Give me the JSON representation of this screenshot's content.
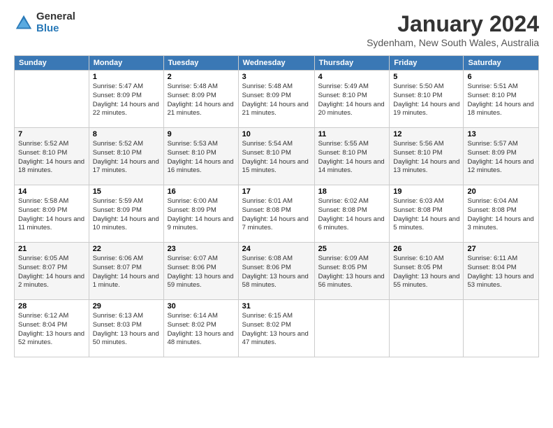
{
  "logo": {
    "general": "General",
    "blue": "Blue"
  },
  "title": "January 2024",
  "location": "Sydenham, New South Wales, Australia",
  "days_header": [
    "Sunday",
    "Monday",
    "Tuesday",
    "Wednesday",
    "Thursday",
    "Friday",
    "Saturday"
  ],
  "weeks": [
    [
      {
        "num": "",
        "sunrise": "",
        "sunset": "",
        "daylight": ""
      },
      {
        "num": "1",
        "sunrise": "Sunrise: 5:47 AM",
        "sunset": "Sunset: 8:09 PM",
        "daylight": "Daylight: 14 hours and 22 minutes."
      },
      {
        "num": "2",
        "sunrise": "Sunrise: 5:48 AM",
        "sunset": "Sunset: 8:09 PM",
        "daylight": "Daylight: 14 hours and 21 minutes."
      },
      {
        "num": "3",
        "sunrise": "Sunrise: 5:48 AM",
        "sunset": "Sunset: 8:09 PM",
        "daylight": "Daylight: 14 hours and 21 minutes."
      },
      {
        "num": "4",
        "sunrise": "Sunrise: 5:49 AM",
        "sunset": "Sunset: 8:10 PM",
        "daylight": "Daylight: 14 hours and 20 minutes."
      },
      {
        "num": "5",
        "sunrise": "Sunrise: 5:50 AM",
        "sunset": "Sunset: 8:10 PM",
        "daylight": "Daylight: 14 hours and 19 minutes."
      },
      {
        "num": "6",
        "sunrise": "Sunrise: 5:51 AM",
        "sunset": "Sunset: 8:10 PM",
        "daylight": "Daylight: 14 hours and 18 minutes."
      }
    ],
    [
      {
        "num": "7",
        "sunrise": "Sunrise: 5:52 AM",
        "sunset": "Sunset: 8:10 PM",
        "daylight": "Daylight: 14 hours and 18 minutes."
      },
      {
        "num": "8",
        "sunrise": "Sunrise: 5:52 AM",
        "sunset": "Sunset: 8:10 PM",
        "daylight": "Daylight: 14 hours and 17 minutes."
      },
      {
        "num": "9",
        "sunrise": "Sunrise: 5:53 AM",
        "sunset": "Sunset: 8:10 PM",
        "daylight": "Daylight: 14 hours and 16 minutes."
      },
      {
        "num": "10",
        "sunrise": "Sunrise: 5:54 AM",
        "sunset": "Sunset: 8:10 PM",
        "daylight": "Daylight: 14 hours and 15 minutes."
      },
      {
        "num": "11",
        "sunrise": "Sunrise: 5:55 AM",
        "sunset": "Sunset: 8:10 PM",
        "daylight": "Daylight: 14 hours and 14 minutes."
      },
      {
        "num": "12",
        "sunrise": "Sunrise: 5:56 AM",
        "sunset": "Sunset: 8:10 PM",
        "daylight": "Daylight: 14 hours and 13 minutes."
      },
      {
        "num": "13",
        "sunrise": "Sunrise: 5:57 AM",
        "sunset": "Sunset: 8:09 PM",
        "daylight": "Daylight: 14 hours and 12 minutes."
      }
    ],
    [
      {
        "num": "14",
        "sunrise": "Sunrise: 5:58 AM",
        "sunset": "Sunset: 8:09 PM",
        "daylight": "Daylight: 14 hours and 11 minutes."
      },
      {
        "num": "15",
        "sunrise": "Sunrise: 5:59 AM",
        "sunset": "Sunset: 8:09 PM",
        "daylight": "Daylight: 14 hours and 10 minutes."
      },
      {
        "num": "16",
        "sunrise": "Sunrise: 6:00 AM",
        "sunset": "Sunset: 8:09 PM",
        "daylight": "Daylight: 14 hours and 9 minutes."
      },
      {
        "num": "17",
        "sunrise": "Sunrise: 6:01 AM",
        "sunset": "Sunset: 8:08 PM",
        "daylight": "Daylight: 14 hours and 7 minutes."
      },
      {
        "num": "18",
        "sunrise": "Sunrise: 6:02 AM",
        "sunset": "Sunset: 8:08 PM",
        "daylight": "Daylight: 14 hours and 6 minutes."
      },
      {
        "num": "19",
        "sunrise": "Sunrise: 6:03 AM",
        "sunset": "Sunset: 8:08 PM",
        "daylight": "Daylight: 14 hours and 5 minutes."
      },
      {
        "num": "20",
        "sunrise": "Sunrise: 6:04 AM",
        "sunset": "Sunset: 8:08 PM",
        "daylight": "Daylight: 14 hours and 3 minutes."
      }
    ],
    [
      {
        "num": "21",
        "sunrise": "Sunrise: 6:05 AM",
        "sunset": "Sunset: 8:07 PM",
        "daylight": "Daylight: 14 hours and 2 minutes."
      },
      {
        "num": "22",
        "sunrise": "Sunrise: 6:06 AM",
        "sunset": "Sunset: 8:07 PM",
        "daylight": "Daylight: 14 hours and 1 minute."
      },
      {
        "num": "23",
        "sunrise": "Sunrise: 6:07 AM",
        "sunset": "Sunset: 8:06 PM",
        "daylight": "Daylight: 13 hours and 59 minutes."
      },
      {
        "num": "24",
        "sunrise": "Sunrise: 6:08 AM",
        "sunset": "Sunset: 8:06 PM",
        "daylight": "Daylight: 13 hours and 58 minutes."
      },
      {
        "num": "25",
        "sunrise": "Sunrise: 6:09 AM",
        "sunset": "Sunset: 8:05 PM",
        "daylight": "Daylight: 13 hours and 56 minutes."
      },
      {
        "num": "26",
        "sunrise": "Sunrise: 6:10 AM",
        "sunset": "Sunset: 8:05 PM",
        "daylight": "Daylight: 13 hours and 55 minutes."
      },
      {
        "num": "27",
        "sunrise": "Sunrise: 6:11 AM",
        "sunset": "Sunset: 8:04 PM",
        "daylight": "Daylight: 13 hours and 53 minutes."
      }
    ],
    [
      {
        "num": "28",
        "sunrise": "Sunrise: 6:12 AM",
        "sunset": "Sunset: 8:04 PM",
        "daylight": "Daylight: 13 hours and 52 minutes."
      },
      {
        "num": "29",
        "sunrise": "Sunrise: 6:13 AM",
        "sunset": "Sunset: 8:03 PM",
        "daylight": "Daylight: 13 hours and 50 minutes."
      },
      {
        "num": "30",
        "sunrise": "Sunrise: 6:14 AM",
        "sunset": "Sunset: 8:02 PM",
        "daylight": "Daylight: 13 hours and 48 minutes."
      },
      {
        "num": "31",
        "sunrise": "Sunrise: 6:15 AM",
        "sunset": "Sunset: 8:02 PM",
        "daylight": "Daylight: 13 hours and 47 minutes."
      },
      {
        "num": "",
        "sunrise": "",
        "sunset": "",
        "daylight": ""
      },
      {
        "num": "",
        "sunrise": "",
        "sunset": "",
        "daylight": ""
      },
      {
        "num": "",
        "sunrise": "",
        "sunset": "",
        "daylight": ""
      }
    ]
  ]
}
